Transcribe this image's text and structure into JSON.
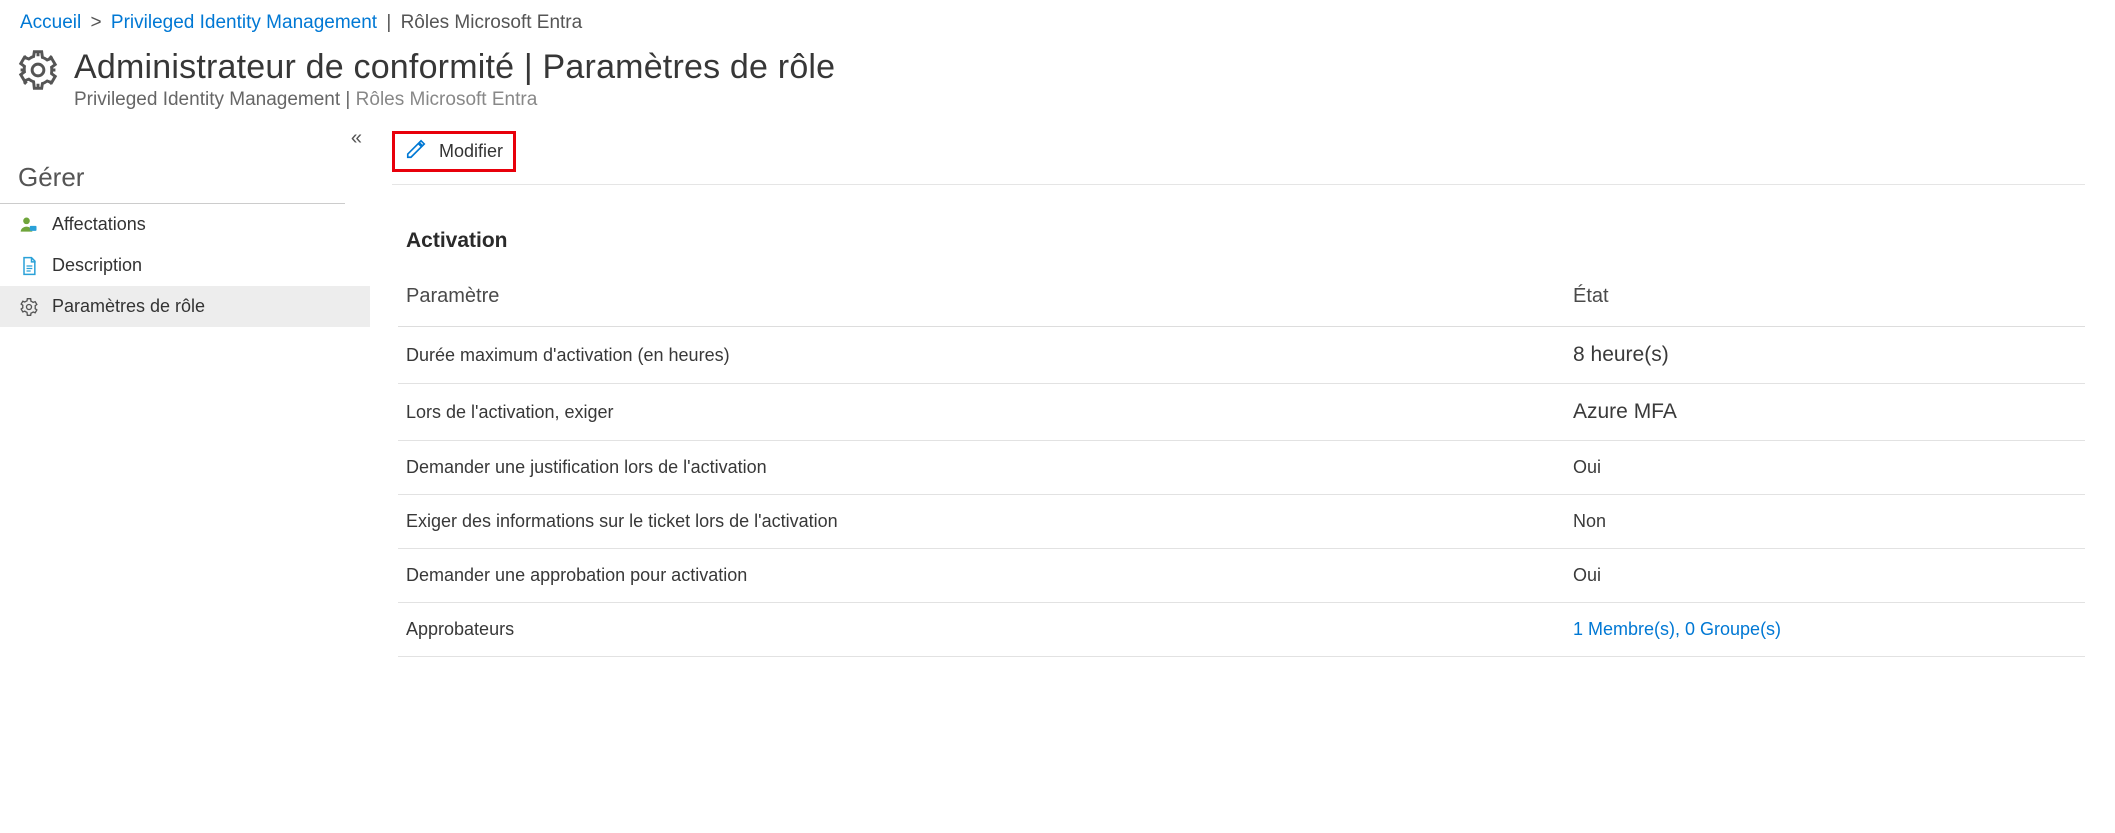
{
  "breadcrumb": {
    "home": "Accueil",
    "pim": "Privileged Identity Management",
    "roles": "Rôles Microsoft Entra"
  },
  "header": {
    "title": "Administrateur de conformité |   Paramètres de rôle",
    "subtitle_a": "Privileged Identity Management | ",
    "subtitle_b": "Rôles Microsoft Entra"
  },
  "sidebar": {
    "collapse_glyph": "«",
    "section": "Gérer",
    "items": [
      {
        "label": "Affectations"
      },
      {
        "label": "Description"
      },
      {
        "label": "Paramètres de rôle"
      }
    ]
  },
  "toolbar": {
    "edit_label": "Modifier"
  },
  "section": {
    "activation_title": "Activation",
    "col_param": "Paramètre",
    "col_state": "État"
  },
  "rows": [
    {
      "param": "Durée maximum d'activation (en heures)",
      "state": "8 heure(s)",
      "big": true
    },
    {
      "param": "Lors de l'activation, exiger",
      "state": "Azure MFA",
      "big": true
    },
    {
      "param": "Demander une justification lors de l'activation",
      "state": "Oui"
    },
    {
      "param": "Exiger des informations sur le ticket lors de l'activation",
      "state": "Non"
    },
    {
      "param": "Demander une approbation pour activation",
      "state": "Oui"
    },
    {
      "param": "Approbateurs",
      "state": "1 Membre(s), 0 Groupe(s)",
      "link": true
    }
  ]
}
